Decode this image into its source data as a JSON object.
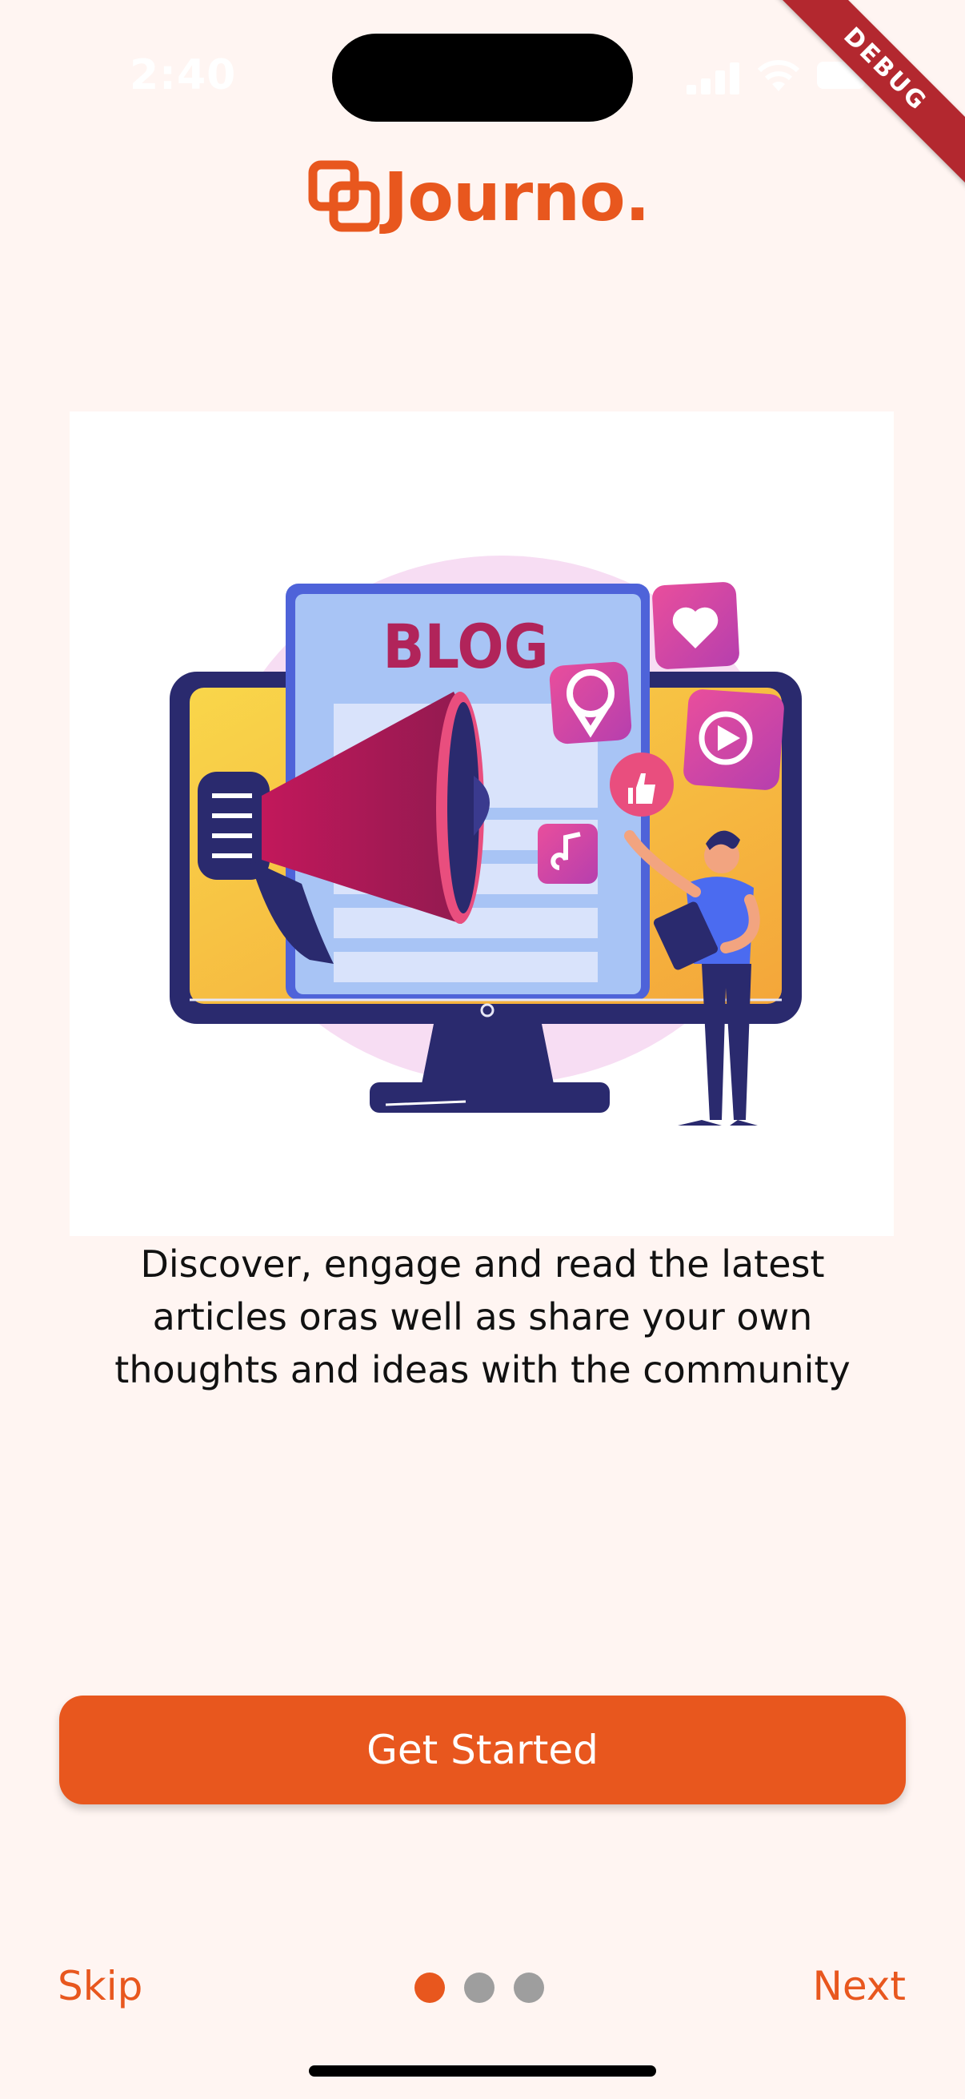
{
  "status_bar": {
    "time": "2:40",
    "icons": [
      "cellular-signal-icon",
      "wifi-icon",
      "battery-icon"
    ]
  },
  "debug_banner": "DEBUG",
  "brand": {
    "name": "Journo.",
    "logo_icon": "journo-logo-icon",
    "color": "#E8571E"
  },
  "illustration": {
    "blog_label": "BLOG",
    "icons": [
      "megaphone-icon",
      "location-pin-icon",
      "heart-icon",
      "play-icon",
      "thumbs-up-icon",
      "music-note-icon"
    ]
  },
  "onboarding": {
    "description": "Discover, engage and read the latest articles oras well as share your own thoughts and ideas with the community",
    "cta_label": "Get Started",
    "skip_label": "Skip",
    "next_label": "Next",
    "page_count": 3,
    "current_page": 1
  },
  "colors": {
    "accent": "#E8571E",
    "background": "#FFF5F2",
    "inactive_dot": "#9E9E9E"
  }
}
